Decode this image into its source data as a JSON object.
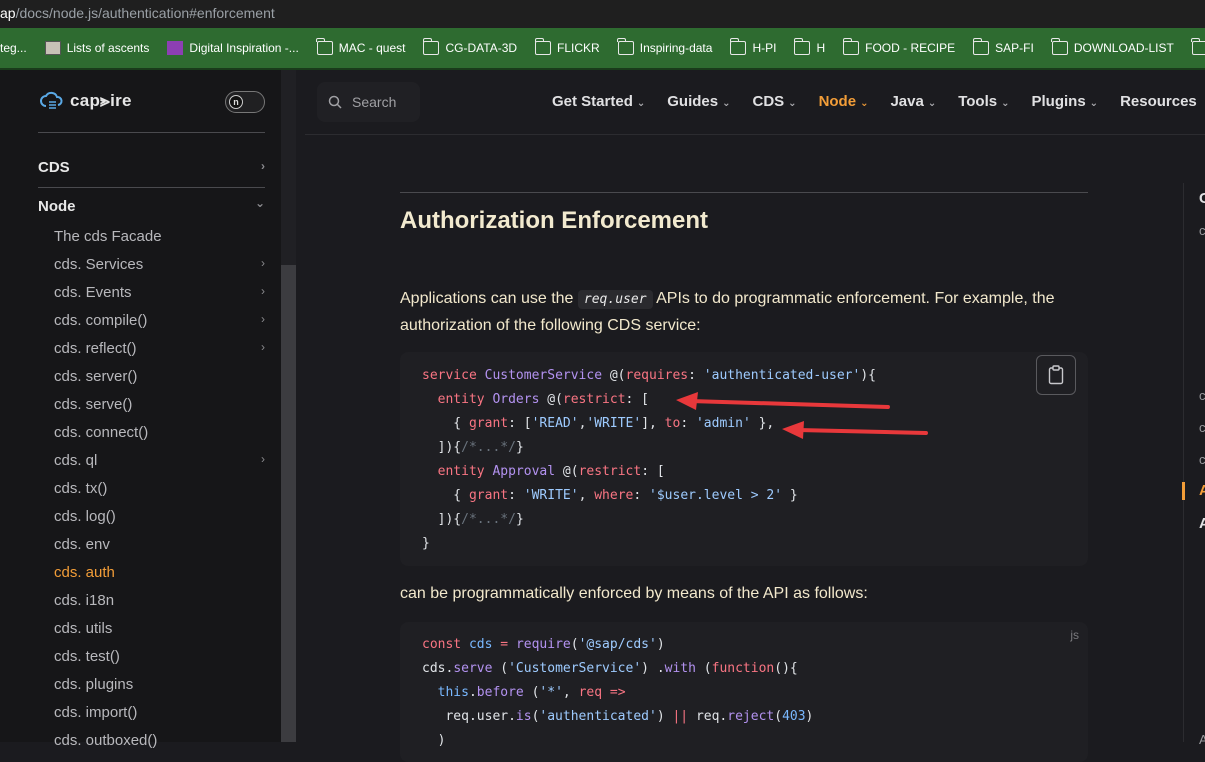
{
  "browser": {
    "url_host": "ap",
    "url_path": "/docs/node.js/authentication#enforcement",
    "bookmarks": [
      {
        "label": "teg...",
        "icon": "none"
      },
      {
        "label": "Lists of ascents",
        "icon": "image-icon"
      },
      {
        "label": "Digital Inspiration -...",
        "icon": "site-icon"
      },
      {
        "label": "MAC - quest",
        "icon": "folder-icon"
      },
      {
        "label": "CG-DATA-3D",
        "icon": "folder-icon"
      },
      {
        "label": "FLICKR",
        "icon": "folder-icon"
      },
      {
        "label": "Inspiring-data",
        "icon": "folder-icon"
      },
      {
        "label": "H-PI",
        "icon": "folder-icon"
      },
      {
        "label": "H",
        "icon": "folder-icon"
      },
      {
        "label": "FOOD - RECIPE",
        "icon": "folder-icon"
      },
      {
        "label": "SAP-FI",
        "icon": "folder-icon"
      },
      {
        "label": "DOWNLOAD-LIST",
        "icon": "folder-icon"
      },
      {
        "label": "",
        "icon": "folder-icon"
      }
    ]
  },
  "sidebar": {
    "logo_text": "cap⪢ire",
    "toggle_glyph": "n",
    "groups": [
      {
        "label": "CDS",
        "chevron": "›"
      },
      {
        "label": "Node",
        "chevron": "⌄"
      }
    ],
    "items": [
      {
        "label": "The cds Facade",
        "chevron": ""
      },
      {
        "label": "cds. Services",
        "chevron": "›"
      },
      {
        "label": "cds. Events",
        "chevron": "›"
      },
      {
        "label": "cds. compile()",
        "chevron": "›"
      },
      {
        "label": "cds. reflect()",
        "chevron": "›"
      },
      {
        "label": "cds. server()",
        "chevron": ""
      },
      {
        "label": "cds. serve()",
        "chevron": ""
      },
      {
        "label": "cds. connect()",
        "chevron": ""
      },
      {
        "label": "cds. ql",
        "chevron": "›"
      },
      {
        "label": "cds. tx()",
        "chevron": ""
      },
      {
        "label": "cds. log()",
        "chevron": ""
      },
      {
        "label": "cds. env",
        "chevron": ""
      },
      {
        "label": "cds. auth",
        "chevron": "",
        "active": true
      },
      {
        "label": "cds. i18n",
        "chevron": ""
      },
      {
        "label": "cds. utils",
        "chevron": ""
      },
      {
        "label": "cds. test()",
        "chevron": ""
      },
      {
        "label": "cds. plugins",
        "chevron": ""
      },
      {
        "label": "cds. import()",
        "chevron": ""
      },
      {
        "label": "cds. outboxed()",
        "chevron": ""
      }
    ]
  },
  "header": {
    "search_label": "Search",
    "nav": [
      {
        "label": "Get Started",
        "active": false
      },
      {
        "label": "Guides",
        "active": false
      },
      {
        "label": "CDS",
        "active": false
      },
      {
        "label": "Node",
        "active": true
      },
      {
        "label": "Java",
        "active": false
      },
      {
        "label": "Tools",
        "active": false
      },
      {
        "label": "Plugins",
        "active": false
      },
      {
        "label": "Resources",
        "active": false
      }
    ],
    "dropdown_glyph": "⌄"
  },
  "main": {
    "title": "Authorization Enforcement",
    "intro_before": "Applications can use the",
    "intro_code": "req.user",
    "intro_after": "APIs to do programmatic enforcement. For example, the authorization of the following CDS service:",
    "between_text": "can be programmatically enforced by means of the API as follows:",
    "code2_lang": "js"
  },
  "outline": {
    "letters": [
      "C",
      "c",
      "c",
      "c",
      "c",
      "A",
      "A",
      "A"
    ]
  },
  "colors": {
    "accent": "#f29d38",
    "arrow": "#e8383b"
  }
}
